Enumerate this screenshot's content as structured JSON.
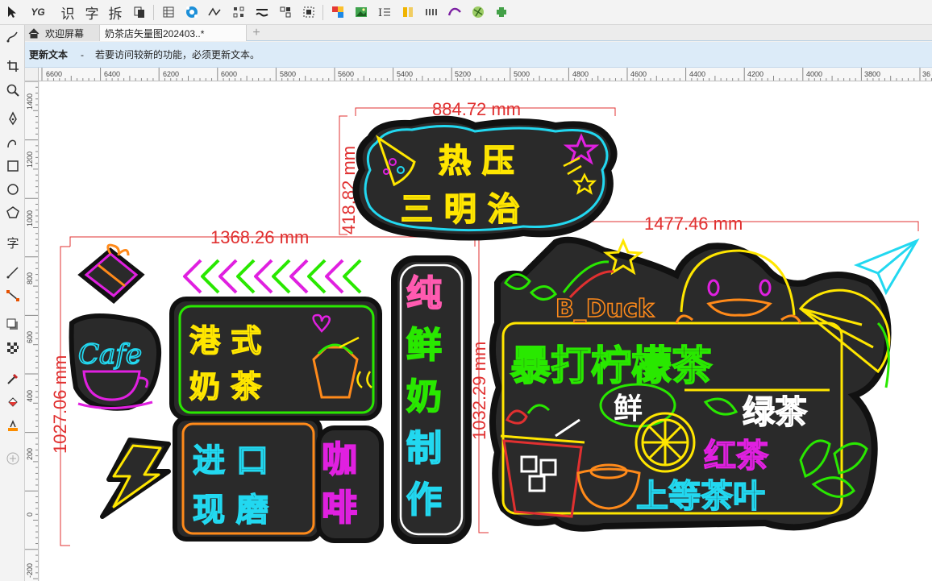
{
  "toolbar": {
    "icons": [
      "pointer-icon",
      "yg-icon",
      "text-tool-icon",
      "char-icon",
      "split-icon",
      "copy-icon",
      "table-icon",
      "pattern-icon",
      "curve-icon",
      "grid-icon",
      "wave-icon",
      "arrange-icon",
      "select-box-icon",
      "color-icon",
      "image-icon",
      "text-align-icon",
      "bars-icon",
      "dots-icon",
      "brush-icon",
      "globe-icon",
      "plugin-icon"
    ],
    "yg_label": "YG",
    "char_labels": [
      "识",
      "字",
      "拆"
    ]
  },
  "tabs": {
    "welcome": "欢迎屏幕",
    "document": "奶茶店矢量图202403..*",
    "add": "+"
  },
  "update_bar": {
    "title": "更新文本",
    "dash": "-",
    "message": "若要访问较新的功能，必须更新文本。"
  },
  "ruler": {
    "h_labels": [
      "6600",
      "6400",
      "6200",
      "6000",
      "5800",
      "5600",
      "5400",
      "5200",
      "5000",
      "4800",
      "4600",
      "4400",
      "4200",
      "4000",
      "3800",
      "36"
    ],
    "v_labels": [
      "1400",
      "1200",
      "1000",
      "800",
      "600",
      "400",
      "200",
      "0",
      "-200"
    ]
  },
  "canvas": {
    "dimensions": {
      "top_width": "884.72 mm",
      "top_height": "418.82 mm",
      "left_width": "1368.26 mm",
      "left_height": "1027.06 mm",
      "right_width": "1477.46 mm",
      "right_height": "1032.29 mm"
    },
    "signs": {
      "sandwich_line1": "热 压",
      "sandwich_line2": "三 明 治",
      "cafe": "Cafe",
      "hk_line1": "港 式",
      "hk_line2": "奶 茶",
      "import_line1": "进 口",
      "import_line2": "现 磨",
      "coffee_line1": "咖",
      "coffee_line2": "啡",
      "milk": [
        "纯",
        "鲜",
        "奶",
        "制",
        "作"
      ],
      "bduck": "B_Duck",
      "lemon_tea": "暴打柠檬茶",
      "fresh": "鲜",
      "green_tea": "绿茶",
      "black_tea": "红茶",
      "premium_tea": "上等茶叶"
    },
    "colors": {
      "neon_yellow": "#ffe600",
      "neon_green": "#29e800",
      "neon_cyan": "#22d8f0",
      "neon_magenta": "#e020e0",
      "neon_orange": "#ff8a1a",
      "neon_pink": "#ff5ab0",
      "board": "#2a2a2a",
      "dimension_red": "#e03030"
    }
  }
}
